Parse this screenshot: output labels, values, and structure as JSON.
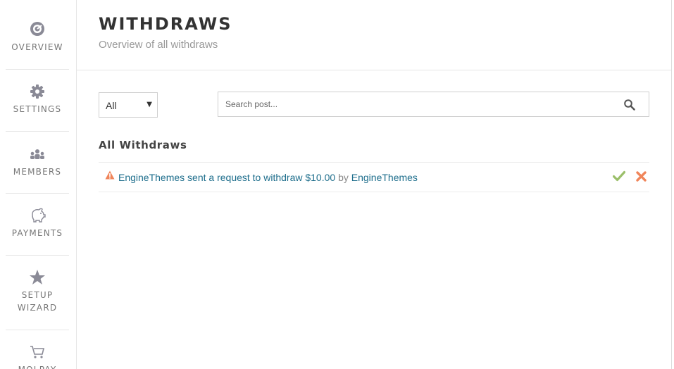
{
  "sidebar": {
    "items": [
      {
        "label": "OVERVIEW",
        "icon": "overview-icon"
      },
      {
        "label": "SETTINGS",
        "icon": "gear-icon"
      },
      {
        "label": "MEMBERS",
        "icon": "members-icon"
      },
      {
        "label": "PAYMENTS",
        "icon": "piggy-bank-icon"
      },
      {
        "label_line1": "SETUP",
        "label_line2": "WIZARD",
        "icon": "star-icon"
      },
      {
        "label": "MOLPAY",
        "icon": "cart-icon"
      }
    ]
  },
  "header": {
    "title": "WITHDRAWS",
    "subtitle": "Overview of all withdraws"
  },
  "filters": {
    "status_selected": "All",
    "search_placeholder": "Search post..."
  },
  "section": {
    "title": "All Withdraws"
  },
  "withdraws": [
    {
      "request_text": "EngineThemes sent a request to withdraw $10.00",
      "by_label": "by",
      "author": "EngineThemes"
    }
  ],
  "colors": {
    "icon_gray": "#8a8a96",
    "link": "#1e6e8c",
    "warning": "#f0855a",
    "approve": "#9bbf6a",
    "reject": "#f0855a"
  }
}
